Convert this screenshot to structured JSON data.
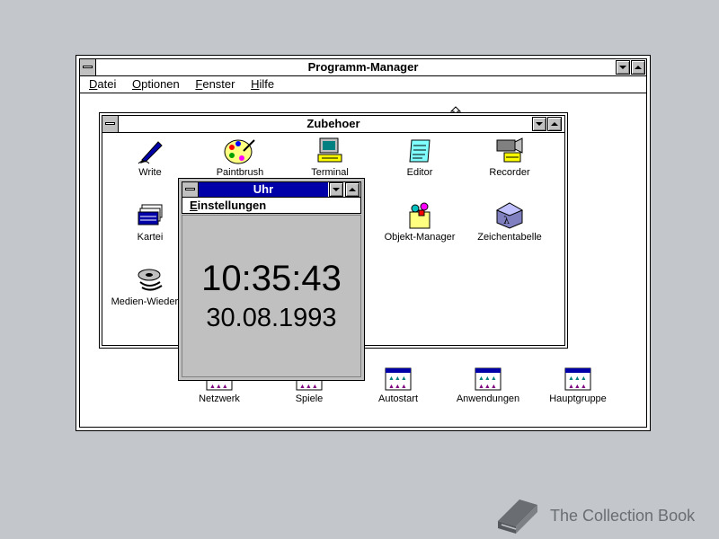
{
  "program_manager": {
    "title": "Programm-Manager",
    "menu": [
      "Datei",
      "Optionen",
      "Fenster",
      "Hilfe"
    ],
    "groups": [
      {
        "label": "Netzwerk"
      },
      {
        "label": "Spiele"
      },
      {
        "label": "Autostart"
      },
      {
        "label": "Anwendungen"
      },
      {
        "label": "Hauptgruppe"
      }
    ]
  },
  "zubehoer": {
    "title": "Zubehoer",
    "icons": [
      {
        "label": "Write",
        "icon": "write-icon"
      },
      {
        "label": "Paintbrush",
        "icon": "paintbrush-icon"
      },
      {
        "label": "Terminal",
        "icon": "terminal-icon"
      },
      {
        "label": "Editor",
        "icon": "editor-icon"
      },
      {
        "label": "Recorder",
        "icon": "recorder-icon"
      },
      {
        "label": "Kartei",
        "icon": "kartei-icon"
      },
      {
        "label": "Objekt-Manager",
        "icon": "objekt-manager-icon"
      },
      {
        "label": "Zeichentabelle",
        "icon": "zeichentabelle-icon"
      },
      {
        "label": "Medien-Wiederga",
        "icon": "medien-wiedergabe-icon"
      }
    ]
  },
  "uhr": {
    "title": "Uhr",
    "menu": "Einstellungen",
    "time": "10:35:43",
    "date": "30.08.1993"
  },
  "watermark": {
    "text": "The Collection Book"
  },
  "colors": {
    "desktop": "#c3c7cb",
    "active_title": "#0000a8",
    "window_bg": "#ffffff",
    "clock_bg": "#c0c0c0"
  }
}
